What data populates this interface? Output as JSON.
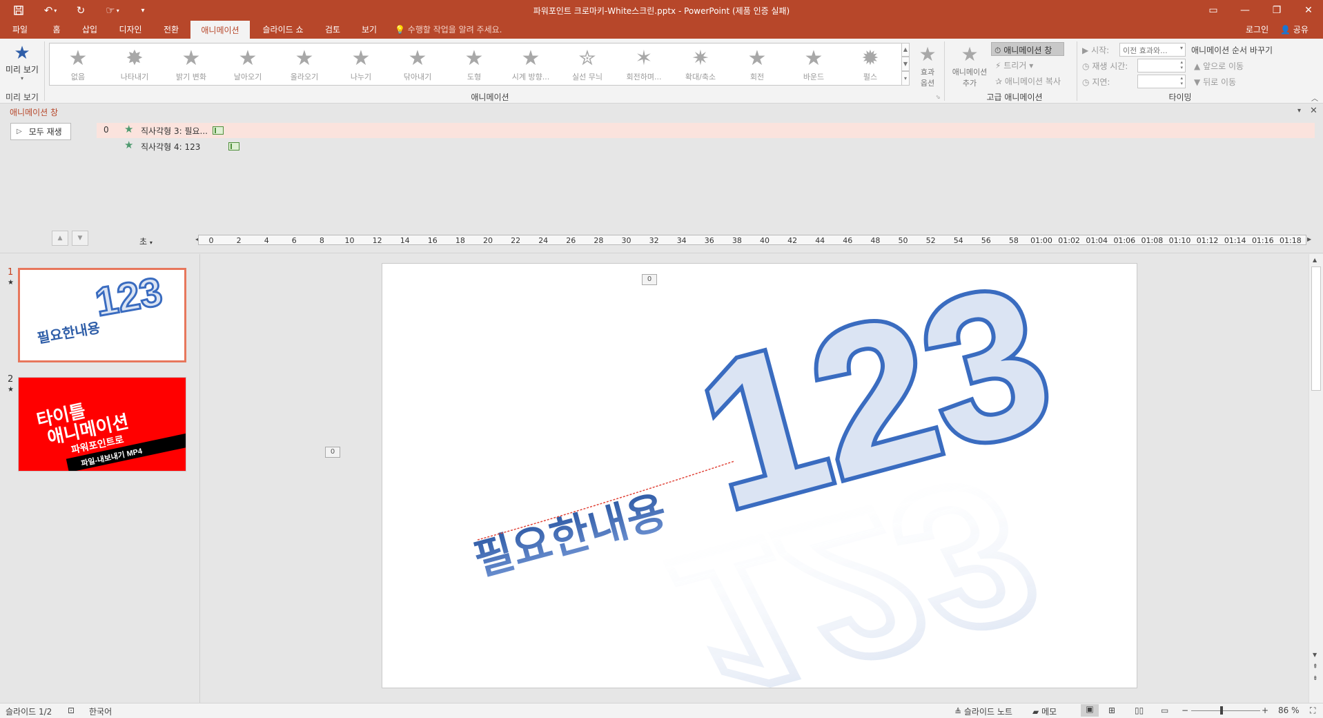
{
  "titlebar": {
    "title": "파워포인트 크로마키-White스크린.pptx - PowerPoint (제품 인증 실패)",
    "quick_access": [
      "save-icon",
      "undo-icon",
      "redo-icon",
      "touch-mode-icon",
      "customize-icon"
    ],
    "window_buttons": [
      "ribbon-display-icon",
      "minimize-icon",
      "restore-icon",
      "close-icon"
    ]
  },
  "tabs": [
    {
      "label": "파일"
    },
    {
      "label": "홈"
    },
    {
      "label": "삽입"
    },
    {
      "label": "디자인"
    },
    {
      "label": "전환"
    },
    {
      "label": "애니메이션"
    },
    {
      "label": "슬라이드 쇼"
    },
    {
      "label": "검토"
    },
    {
      "label": "보기"
    }
  ],
  "active_tab": "애니메이션",
  "tell_me": "수행할 작업을 알려 주세요.",
  "signin": "로그인",
  "share": "공유",
  "ribbon": {
    "preview_btn": "미리 보기",
    "preview_group": "미리 보기",
    "animations": [
      "없음",
      "나타내기",
      "밝기 변화",
      "날아오기",
      "올라오기",
      "나누기",
      "닦아내기",
      "도형",
      "시계 방향...",
      "실선 무늬",
      "회전하며...",
      "확대/축소",
      "회전",
      "바운드",
      "펄스"
    ],
    "effect_options": [
      "효과",
      "옵션"
    ],
    "animation_group": "애니메이션",
    "add_animation": [
      "애니메이션",
      "추가"
    ],
    "anim_pane_btn": "애니메이션 창",
    "trigger": "트리거",
    "anim_painter": "애니메이션 복사",
    "advanced_group": "고급 애니메이션",
    "start_label": "시작:",
    "start_value": "이전 효과와...",
    "duration_label": "재생 시간:",
    "delay_label": "지연:",
    "reorder_title": "애니메이션 순서 바꾸기",
    "move_earlier": "앞으로 이동",
    "move_later": "뒤로 이동",
    "timing_group": "타이밍"
  },
  "anim_pane": {
    "title": "애니메이션 창",
    "play_all": "모두 재생",
    "items": [
      {
        "order": "0",
        "name": "직사각형 3: 필요...",
        "selected": true
      },
      {
        "order": "",
        "name": "직사각형 4: 123",
        "selected": false
      }
    ]
  },
  "timeline": {
    "unit": "초",
    "ticks": [
      "0",
      "2",
      "4",
      "6",
      "8",
      "10",
      "12",
      "14",
      "16",
      "18",
      "20",
      "22",
      "24",
      "26",
      "28",
      "30",
      "32",
      "34",
      "36",
      "38",
      "40",
      "42",
      "44",
      "46",
      "48",
      "50",
      "52",
      "54",
      "56",
      "58",
      "01:00",
      "01:02",
      "01:04",
      "01:06",
      "01:08",
      "01:10",
      "01:12",
      "01:14",
      "01:16",
      "01:18"
    ]
  },
  "slides": [
    {
      "number": "1",
      "text_a": "필요한내용",
      "text_b": "123"
    },
    {
      "number": "2",
      "line1": "타이틀",
      "line2": "애니메이션",
      "line3": "파워포인트로",
      "line4": "파일-내보내기 MP4"
    }
  ],
  "slide_main": {
    "text_korean": "필요한내용",
    "text_big": "123",
    "anim_tag_a": "0",
    "anim_tag_b": "0"
  },
  "status": {
    "slide": "슬라이드 1/2",
    "language": "한국어",
    "notes": "슬라이드 노트",
    "comments": "메모",
    "zoom": "86 %"
  },
  "colors": {
    "accent": "#b7472a",
    "text_blue": "#2f5ea8",
    "text_fill": "#dbe4f3",
    "thumb2_bg": "#ff0000"
  }
}
